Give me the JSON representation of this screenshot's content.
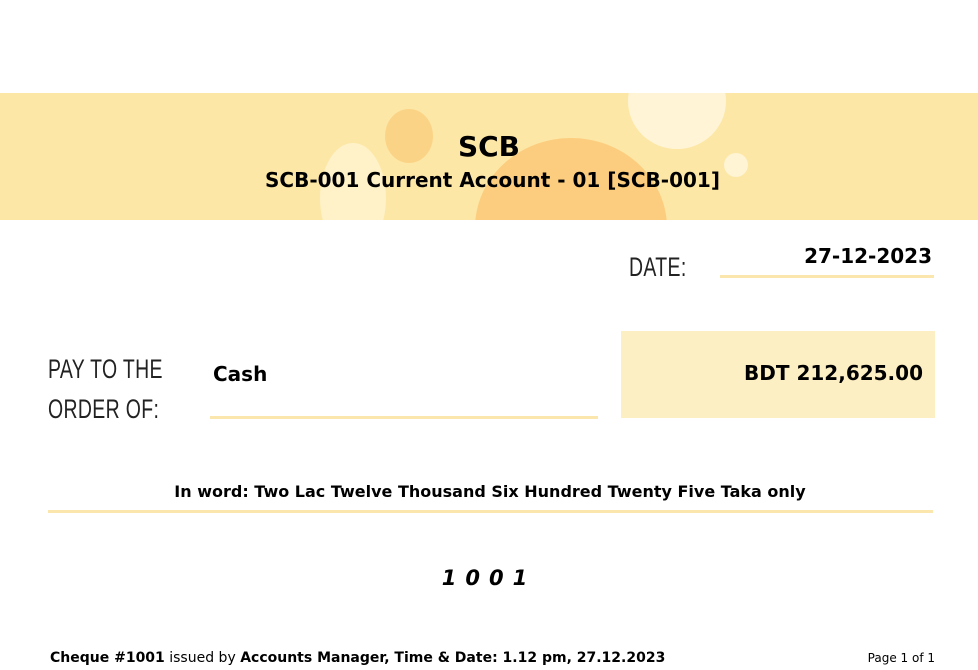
{
  "header": {
    "bank_name": "SCB",
    "account_line": "SCB-001 Current Account - 01 [SCB-001]"
  },
  "date": {
    "label": "DATE:",
    "value": "27-12-2023"
  },
  "payee": {
    "label_line1": "PAY TO THE",
    "label_line2": "ORDER OF:",
    "value": "Cash"
  },
  "amount": {
    "value": "BDT 212,625.00"
  },
  "in_words": "In word: Two Lac Twelve Thousand Six Hundred Twenty Five Taka only",
  "cheque_number": "1001",
  "footer": {
    "cheque_ref": "Cheque #1001",
    "issued_by_text": "issued by",
    "issuer_details": "Accounts Manager, Time & Date: 1.12 pm, 27.12.2023",
    "page_info": "Page 1 of 1"
  },
  "colors": {
    "banner": "#fde7a6",
    "accent_dark": "#fccd7e",
    "underline": "#fbe7ad",
    "amount_box": "#fdefc4"
  }
}
